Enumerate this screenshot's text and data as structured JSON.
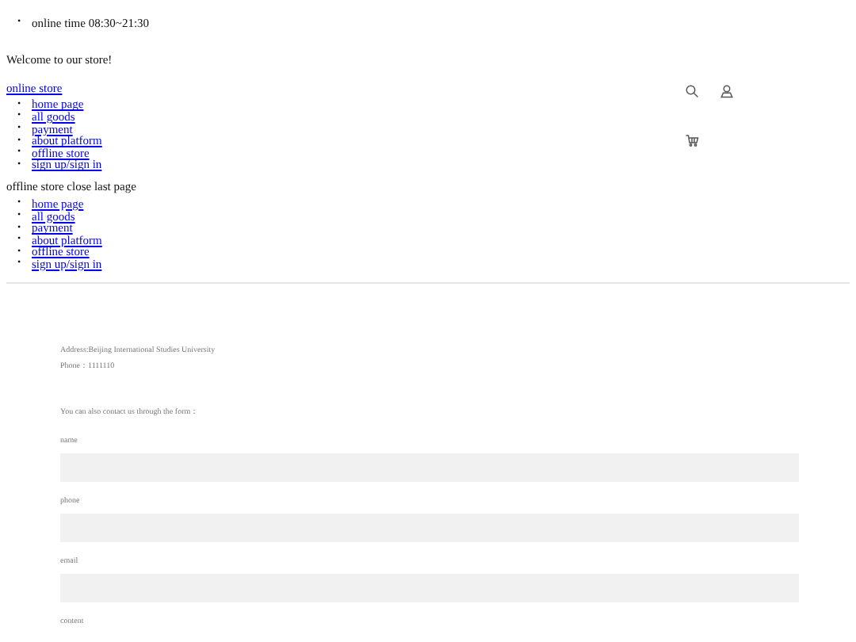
{
  "bullet": "•",
  "top_bar": {
    "items": [
      "online time 08:30~21:30"
    ]
  },
  "welcome": "Welcome to our store!",
  "logo_link": "online store",
  "nav": [
    "home page",
    "all goods",
    "payment",
    "about platform",
    "offline store",
    "sign up/sign in"
  ],
  "mobile_menu": {
    "title": "offline store close last page",
    "items": [
      "home page",
      "all goods",
      "payment",
      "about platform",
      "offline store",
      "sign up/sign in"
    ]
  },
  "contact": {
    "address": "Address:Beijing International Studies University",
    "phone": "Phone：1111110",
    "intro": "You can also contact us through the form：",
    "fields": [
      {
        "label": "name"
      },
      {
        "label": "phone"
      },
      {
        "label": "email"
      },
      {
        "label": "content"
      }
    ]
  }
}
